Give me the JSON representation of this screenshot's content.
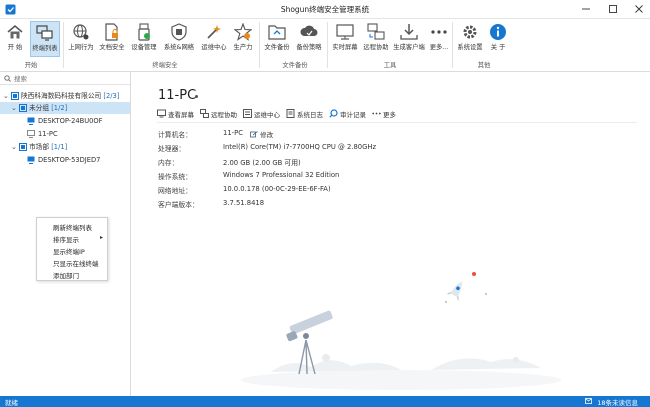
{
  "window": {
    "title": "Shogun终端安全管理系统",
    "minimize": "minimize",
    "maximize": "maximize",
    "close": "close"
  },
  "ribbon": {
    "buttons": [
      {
        "label": "开 始",
        "icon": "home-icon"
      },
      {
        "label": "终端列表",
        "icon": "terminal-list-icon"
      },
      {
        "label": "上网行为",
        "icon": "web-behavior-icon"
      },
      {
        "label": "文档安全",
        "icon": "document-security-icon"
      },
      {
        "label": "设备管理",
        "icon": "device-management-icon"
      },
      {
        "label": "系统&网络",
        "icon": "system-network-icon"
      },
      {
        "label": "运维中心",
        "icon": "ops-center-icon"
      },
      {
        "label": "生产力",
        "icon": "productivity-icon"
      },
      {
        "label": "文件备份",
        "icon": "file-backup-icon"
      },
      {
        "label": "备份策略",
        "icon": "backup-policy-icon"
      },
      {
        "label": "实时屏幕",
        "icon": "realtime-screen-icon"
      },
      {
        "label": "远程协助",
        "icon": "remote-assist-icon"
      },
      {
        "label": "生成客户端",
        "icon": "generate-client-icon"
      },
      {
        "label": "更多...",
        "icon": "more-icon"
      },
      {
        "label": "系统设置",
        "icon": "settings-icon"
      },
      {
        "label": "关 于",
        "icon": "info-icon"
      }
    ],
    "groups": [
      "开始",
      "终端安全",
      "文件备份",
      "工具",
      "其他"
    ]
  },
  "sidebar": {
    "search_placeholder": "搜索",
    "tree": [
      {
        "label": "陕西科海数码科技有限公司",
        "count": "[2/3]"
      },
      {
        "label": "未分组",
        "count": "[1/2]"
      },
      {
        "label": "DESKTOP-24BU0OF",
        "count": ""
      },
      {
        "label": "11-PC",
        "count": ""
      },
      {
        "label": "市场部",
        "count": "[1/1]"
      },
      {
        "label": "DESKTOP-53DJED7",
        "count": ""
      }
    ]
  },
  "context_menu": {
    "items": [
      "刷新终端列表",
      "排序显示",
      "显示终端IP",
      "只显示在线终端",
      "添加部门"
    ]
  },
  "detail": {
    "title": "11-PC",
    "actions": [
      "查看屏幕",
      "远程协助",
      "运维中心",
      "系统日志",
      "审计记录",
      "更多"
    ],
    "edit_label": "修改",
    "rows": [
      {
        "key": "计算机名：",
        "value": "11-PC"
      },
      {
        "key": "处理器：",
        "value": "Intel(R) Core(TM) i7-7700HQ CPU @ 2.80GHz"
      },
      {
        "key": "内存：",
        "value": "2.00 GB (2.00 GB 可用)"
      },
      {
        "key": "操作系统：",
        "value": "Windows 7 Professional 32 Edition"
      },
      {
        "key": "网络地址：",
        "value": "10.0.0.178  (00-0C-29-EE-6F-FA)"
      },
      {
        "key": "客户端版本：",
        "value": "3.7.51.8418"
      }
    ]
  },
  "status": {
    "left": "就绪",
    "right": "18条未读信息"
  },
  "colors": {
    "accent": "#1677d2",
    "selection": "#cde4f7",
    "status_bar": "#1677d2"
  }
}
